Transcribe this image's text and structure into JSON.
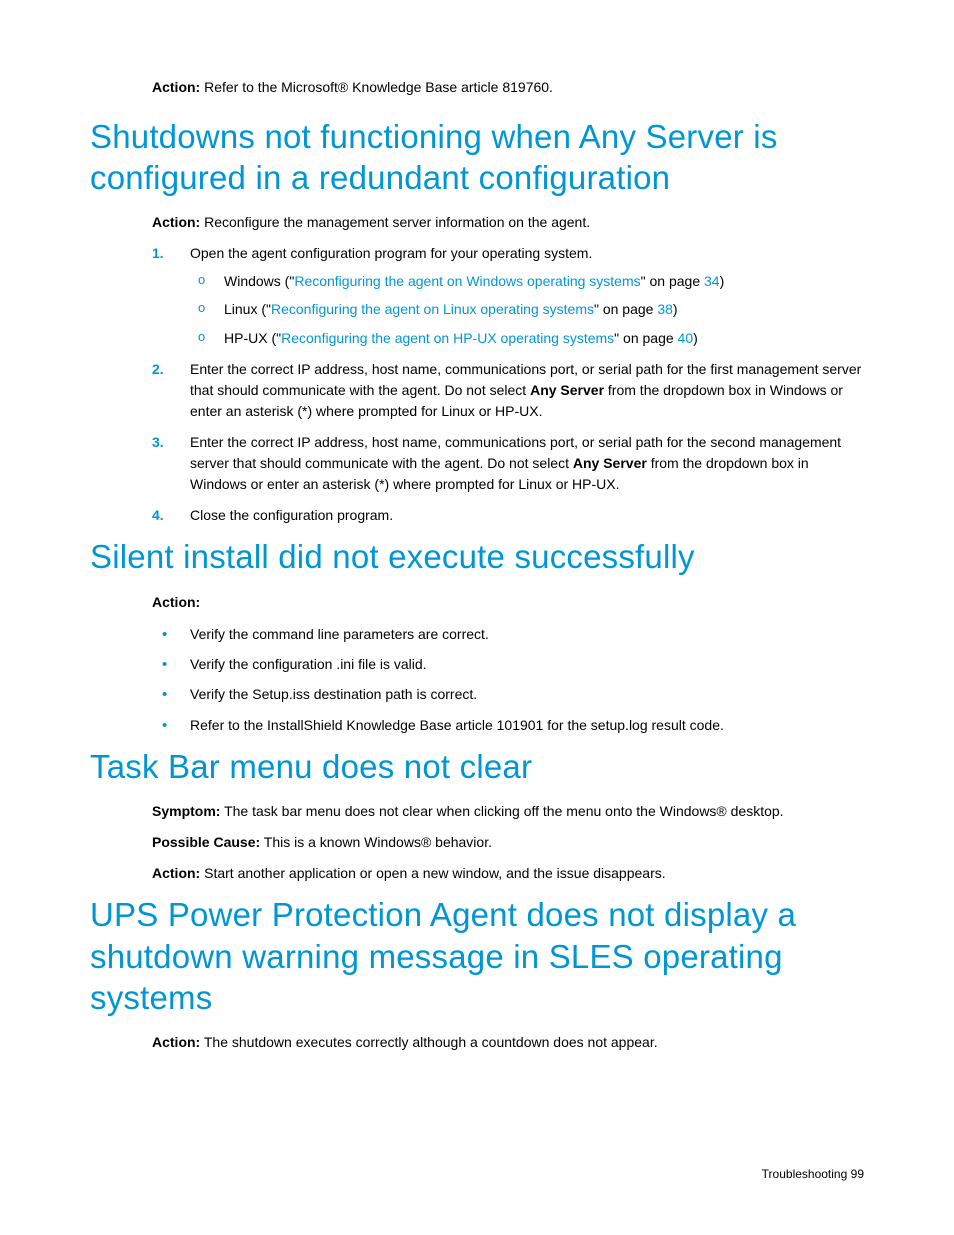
{
  "top": {
    "action_label": "Action:",
    "action_text": " Refer to the Microsoft® Knowledge Base article 819760."
  },
  "s1": {
    "heading": "Shutdowns not functioning when Any Server is configured in a redundant configuration",
    "action_label": "Action:",
    "action_text": " Reconfigure the management server information on the agent.",
    "step1_num": "1.",
    "step1_text": "Open the agent configuration program for your operating system.",
    "sub_marker": "o",
    "sub1_pre": "Windows (\"",
    "sub1_link": "Reconfiguring the agent on Windows operating systems",
    "sub1_mid": "\" on page ",
    "sub1_page": "34",
    "sub1_end": ")",
    "sub2_pre": "Linux (\"",
    "sub2_link": "Reconfiguring the agent on Linux operating systems",
    "sub2_mid": "\" on page ",
    "sub2_page": "38",
    "sub2_end": ")",
    "sub3_pre": "HP-UX (\"",
    "sub3_link": "Reconfiguring the agent on HP-UX operating systems",
    "sub3_mid": "\" on page ",
    "sub3_page": "40",
    "sub3_end": ")",
    "step2_num": "2.",
    "step2_a": "Enter the correct IP address, host name, communications port, or serial path for the first management server that should communicate with the agent. Do not select ",
    "step2_b": "Any Server",
    "step2_c": " from the dropdown box in Windows or enter an asterisk (*) where prompted for Linux or HP-UX.",
    "step3_num": "3.",
    "step3_a": "Enter the correct IP address, host name, communications port, or serial path for the second management server that should communicate with the agent. Do not select ",
    "step3_b": "Any Server",
    "step3_c": " from the dropdown box in Windows or enter an asterisk (*) where prompted for Linux or HP-UX.",
    "step4_num": "4.",
    "step4_text": "Close the configuration program."
  },
  "s2": {
    "heading": "Silent install did not execute successfully",
    "action_label": "Action:",
    "b1": "Verify the command line parameters are correct.",
    "b2": "Verify the configuration .ini file is valid.",
    "b3": "Verify the Setup.iss destination path is correct.",
    "b4": "Refer to the InstallShield Knowledge Base article 101901 for the setup.log result code.",
    "dot": "•"
  },
  "s3": {
    "heading": "Task Bar menu does not clear",
    "symptom_label": "Symptom:",
    "symptom_text": " The task bar menu does not clear when clicking off the menu onto the Windows® desktop.",
    "cause_label": "Possible Cause:",
    "cause_text": " This is a known Windows® behavior.",
    "action_label": "Action:",
    "action_text": " Start another application or open a new window, and the issue disappears."
  },
  "s4": {
    "heading": "UPS Power Protection Agent does not display a shutdown warning message in SLES operating systems",
    "action_label": "Action:",
    "action_text": " The shutdown executes correctly although a countdown does not appear."
  },
  "footer": {
    "section": "Troubleshooting",
    "sep": "   ",
    "page": "99"
  }
}
